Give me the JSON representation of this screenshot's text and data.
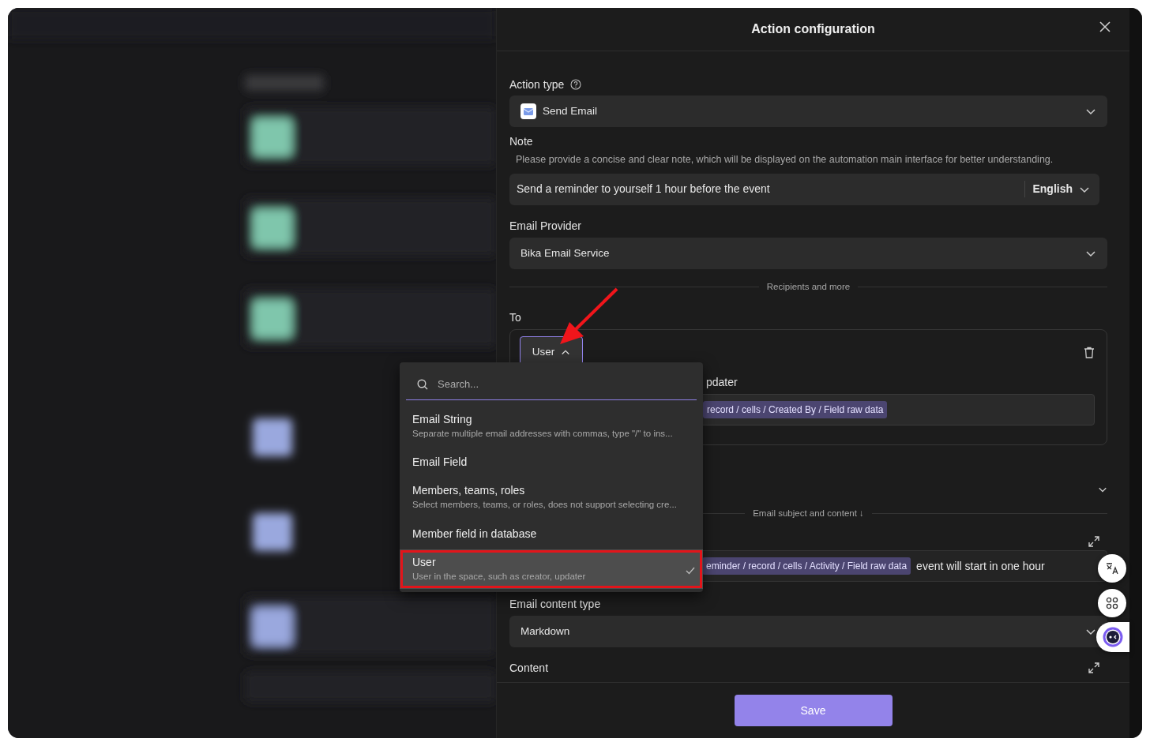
{
  "dialog": {
    "title": "Action configuration"
  },
  "action_type": {
    "label": "Action type",
    "value": "Send Email"
  },
  "note": {
    "label": "Note",
    "hint": "Please provide a concise and clear note, which will be displayed on the automation main interface for better understanding.",
    "value": "Send a reminder to yourself 1 hour before the event",
    "language": "English"
  },
  "email_provider": {
    "label": "Email Provider",
    "value": "Bika Email Service"
  },
  "recipients_divider": "Recipients and more",
  "to": {
    "label": "To",
    "type_button": {
      "label": "User",
      "expanded": true
    },
    "field_label": "pdater",
    "tag": "record / cells / Created By / Field raw data"
  },
  "subject_divider": "Email subject and content ↓",
  "subject": {
    "tag": "eminder / record / cells / Activity / Field raw data",
    "text": "event will start in one hour"
  },
  "content_type": {
    "label": "Email content type",
    "value": "Markdown"
  },
  "content": {
    "label": "Content"
  },
  "save_button": "Save",
  "dropdown": {
    "search": {
      "placeholder": "Search..."
    },
    "options": [
      {
        "title": "Email String",
        "description": "Separate multiple email addresses with commas, type \"/\" to ins...",
        "selected": false,
        "highlighted": false
      },
      {
        "title": "Email Field",
        "selected": false,
        "highlighted": false
      },
      {
        "title": "Members, teams, roles",
        "description": "Select members, teams, or roles, does not support selecting cre...",
        "selected": false,
        "highlighted": false
      },
      {
        "title": "Member field in database",
        "selected": false,
        "highlighted": false
      },
      {
        "title": "User",
        "description": "User in the space, such as creator, updater",
        "selected": true,
        "highlighted": true
      }
    ]
  }
}
